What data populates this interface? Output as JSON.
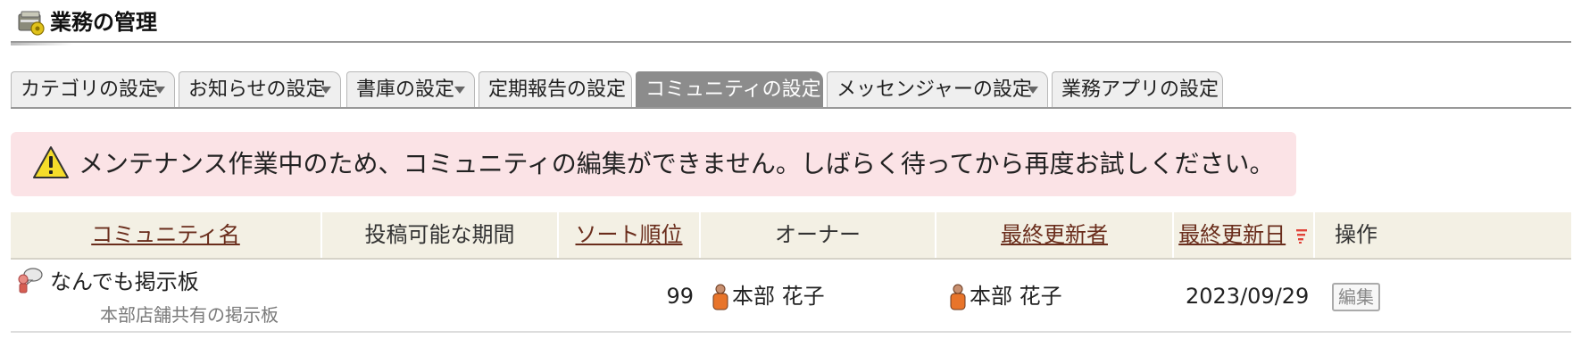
{
  "page": {
    "title": "業務の管理"
  },
  "tabs": [
    {
      "label": "カテゴリの設定",
      "dropdown": true,
      "active": false
    },
    {
      "label": "お知らせの設定",
      "dropdown": true,
      "active": false
    },
    {
      "label": "書庫の設定",
      "dropdown": true,
      "active": false
    },
    {
      "label": "定期報告の設定",
      "dropdown": false,
      "active": false
    },
    {
      "label": "コミュニティの設定",
      "dropdown": false,
      "active": true
    },
    {
      "label": "メッセンジャーの設定",
      "dropdown": true,
      "active": false
    },
    {
      "label": "業務アプリの設定",
      "dropdown": false,
      "active": false
    }
  ],
  "alert": {
    "message": "メンテナンス作業中のため、コミュニティの編集ができません。しばらく待ってから再度お試しください。"
  },
  "table": {
    "headers": {
      "name": "コミュニティ名",
      "period": "投稿可能な期間",
      "sort_order": "ソート順位",
      "owner": "オーナー",
      "last_updater": "最終更新者",
      "last_updated": "最終更新日",
      "actions": "操作"
    },
    "rows": [
      {
        "name": "なんでも掲示板",
        "description": "本部店舗共有の掲示板",
        "period": "",
        "sort_order": "99",
        "owner": "本部 花子",
        "last_updater": "本部 花子",
        "last_updated": "2023/09/29",
        "edit_label": "編集"
      }
    ]
  },
  "colors": {
    "header_link": "#6a2d1c",
    "alert_bg": "#fbe3e6",
    "active_tab": "#8c8c8c",
    "table_header_bg": "#f3f0e4",
    "sort_icon": "#e0443a"
  },
  "icons": {
    "title": "business-manager-icon",
    "alert": "warning-icon",
    "community": "community-chat-icon",
    "person": "person-icon",
    "sort": "sort-descending-icon"
  }
}
